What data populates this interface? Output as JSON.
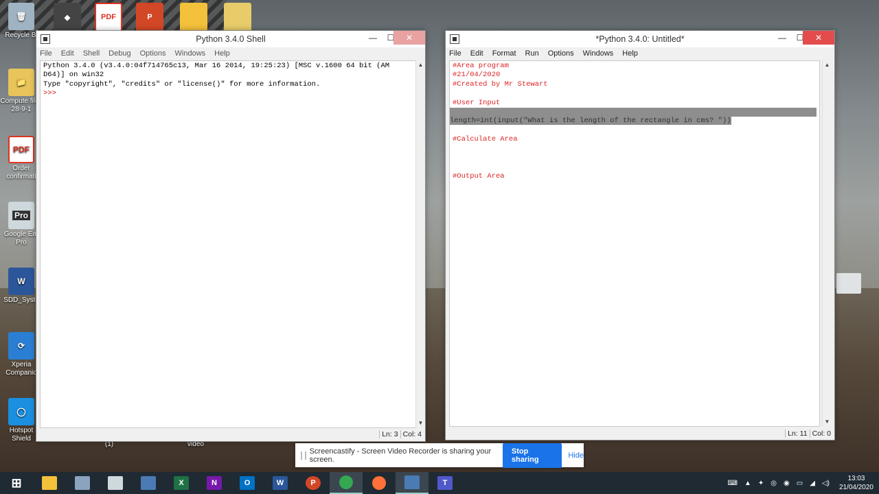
{
  "desktop": {
    "icons": [
      {
        "label": "Recycle Bi",
        "glyph": "🗑"
      },
      {
        "label": "Compute files 28-9-1",
        "glyph": "📁"
      },
      {
        "label": "Order confirmati",
        "glyph": "PDF"
      },
      {
        "label": "Google Ear Pro",
        "glyph": "Pro"
      },
      {
        "label": "SDD_Syste",
        "glyph": "W"
      },
      {
        "label": "Xperia Companio",
        "glyph": "⟳"
      },
      {
        "label": "Hotspot Shield",
        "glyph": "◯"
      }
    ],
    "top_icons": [
      "◆",
      "PDF",
      "P",
      "",
      ""
    ],
    "stray_labels": [
      "(1)",
      "video"
    ]
  },
  "shell": {
    "title": "Python 3.4.0 Shell",
    "menu": [
      "File",
      "Edit",
      "Shell",
      "Debug",
      "Options",
      "Windows",
      "Help"
    ],
    "lines": [
      "Python 3.4.0 (v3.4.0:04f714765c13, Mar 16 2014, 19:25:23) [MSC v.1600 64 bit (AM",
      "D64)] on win32",
      "Type \"copyright\", \"credits\" or \"license()\" for more information.",
      ">>> "
    ],
    "status_ln": "Ln: 3",
    "status_col": "Col: 4"
  },
  "editor": {
    "title": "*Python 3.4.0: Untitled*",
    "menu": [
      "File",
      "Edit",
      "Format",
      "Run",
      "Options",
      "Windows",
      "Help"
    ],
    "lines": [
      "#Area program",
      "#21/04/2020",
      "#Created by Mr Stewart",
      "",
      "#User Input",
      "",
      "length=int(input(\"What is the length of the rectangle in cms? \"))",
      "",
      "#Calculate Area",
      "",
      "",
      "",
      "#Output Area"
    ],
    "status_ln": "Ln: 11",
    "status_col": "Col: 0"
  },
  "banner": {
    "message": "Screencastify - Screen Video Recorder is sharing your screen.",
    "stop_label": "Stop sharing",
    "hide_label": "Hide"
  },
  "taskbar": {
    "apps": [
      {
        "name": "start",
        "glyph": "⊞",
        "color": "#ffffff"
      },
      {
        "name": "file-explorer",
        "glyph": "📁",
        "color": "#f3c13a"
      },
      {
        "name": "calculator",
        "glyph": "▦",
        "color": "#8aa4c0"
      },
      {
        "name": "snipping",
        "glyph": "✂",
        "color": "#cfd8dc"
      },
      {
        "name": "idle-1",
        "glyph": "🐍",
        "color": "#4b7bb5"
      },
      {
        "name": "excel",
        "glyph": "X",
        "color": "#1e7145"
      },
      {
        "name": "onenote",
        "glyph": "N",
        "color": "#7719aa"
      },
      {
        "name": "outlook",
        "glyph": "O",
        "color": "#0072c6"
      },
      {
        "name": "word",
        "glyph": "W",
        "color": "#2b579a"
      },
      {
        "name": "powerpoint",
        "glyph": "P",
        "color": "#d24726"
      },
      {
        "name": "chrome",
        "glyph": "◉",
        "color": "#34a853"
      },
      {
        "name": "firefox",
        "glyph": "●",
        "color": "#ff7139"
      },
      {
        "name": "idle-2",
        "glyph": "🐍",
        "color": "#4b7bb5"
      },
      {
        "name": "teams",
        "glyph": "T",
        "color": "#5059c9"
      }
    ],
    "time": "13:03",
    "date": "21/04/2020"
  }
}
